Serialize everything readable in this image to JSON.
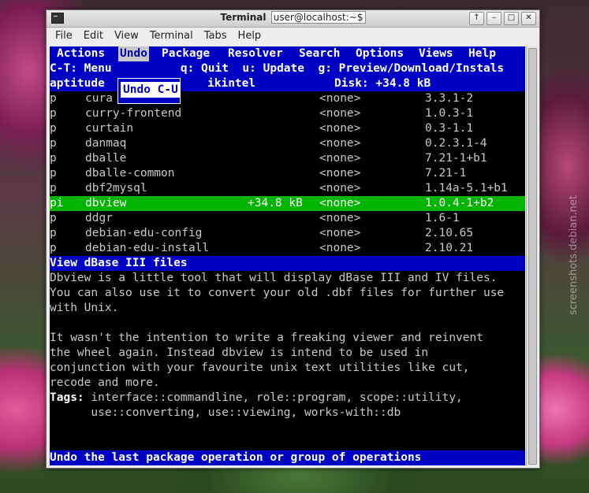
{
  "watermark": "screenshots.debian.net",
  "window": {
    "title": "Terminal",
    "host": "user@localhost:~$"
  },
  "menubar": [
    "File",
    "Edit",
    "View",
    "Terminal",
    "Tabs",
    "Help"
  ],
  "aptitude": {
    "menus": [
      "Actions",
      "Undo",
      "Package",
      "Resolver",
      "Search",
      "Options",
      "Views",
      "Help"
    ],
    "active_menu": "Undo",
    "keys_line": "C-T: Menu          q: Quit  u: Update  g: Preview/Download/Instals",
    "status_left": "aptitude",
    "status_mid": "ikintel",
    "status_right": "Disk: +34.8 kB",
    "popup_item": "Undo C-U",
    "packages": [
      {
        "state": "p",
        "name": "cura",
        "size": "",
        "installed": "<none>",
        "version": "3.3.1-2"
      },
      {
        "state": "p",
        "name": "curry-frontend",
        "size": "",
        "installed": "<none>",
        "version": "1.0.3-1"
      },
      {
        "state": "p",
        "name": "curtain",
        "size": "",
        "installed": "<none>",
        "version": "0.3-1.1"
      },
      {
        "state": "p",
        "name": "danmaq",
        "size": "",
        "installed": "<none>",
        "version": "0.2.3.1-4"
      },
      {
        "state": "p",
        "name": "dballe",
        "size": "",
        "installed": "<none>",
        "version": "7.21-1+b1"
      },
      {
        "state": "p",
        "name": "dballe-common",
        "size": "",
        "installed": "<none>",
        "version": "7.21-1"
      },
      {
        "state": "p",
        "name": "dbf2mysql",
        "size": "",
        "installed": "<none>",
        "version": "1.14a-5.1+b1"
      },
      {
        "state": "pi",
        "name": "dbview",
        "size": "+34.8 kB",
        "installed": "<none>",
        "version": "1.0.4-1+b2"
      },
      {
        "state": "p",
        "name": "ddgr",
        "size": "",
        "installed": "<none>",
        "version": "1.6-1"
      },
      {
        "state": "p",
        "name": "debian-edu-config",
        "size": "",
        "installed": "<none>",
        "version": "2.10.65"
      },
      {
        "state": "p",
        "name": "debian-edu-install",
        "size": "",
        "installed": "<none>",
        "version": "2.10.21"
      }
    ],
    "desc_title": "View dBase III files",
    "desc_lines": [
      "Dbview is a little tool that will display dBase III and IV files.",
      "You can also use it to convert your old .dbf files for further use",
      "with Unix.",
      "",
      "It wasn't the intention to write a freaking viewer and reinvent",
      "the wheel again. Instead dbview is intend to be used in",
      "conjunction with your favourite unix text utilities like cut,",
      "recode and more."
    ],
    "tags_label": "Tags:",
    "tags_line1": " interface::commandline, role::program, scope::utility,",
    "tags_line2": "      use::converting, use::viewing, works-with::db",
    "bottom_status": "Undo the last package operation or group of operations"
  }
}
